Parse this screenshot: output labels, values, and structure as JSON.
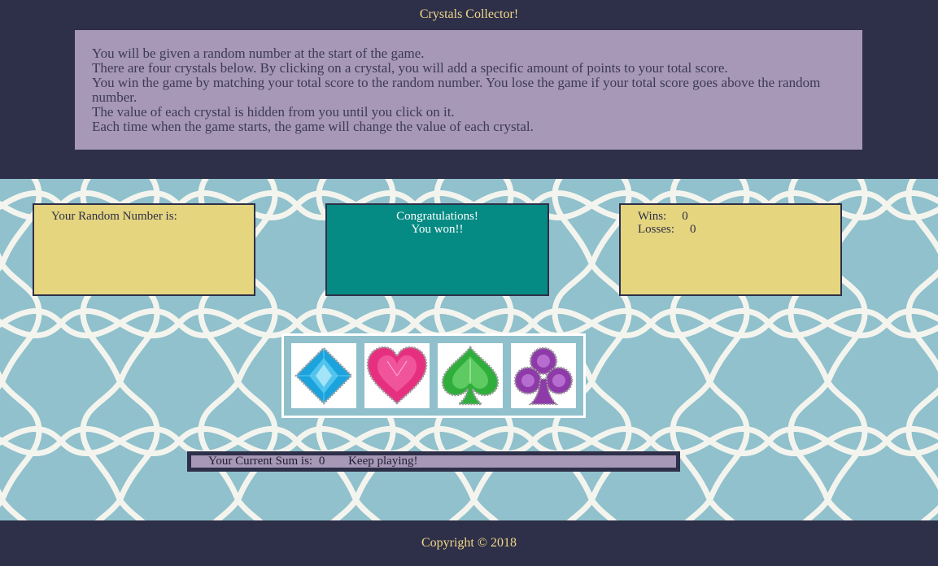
{
  "header": {
    "title": "Crystals Collector!",
    "instructions": [
      "You will be given a random number at the start of the game.",
      "There are four crystals below. By clicking on a crystal, you will add a specific amount of points to your total score.",
      "You win the game by matching your total score to the random number. You lose the game if your total score goes above the random number.",
      "The value of each crystal is hidden from you until you click on it.",
      "Each time when the game starts, the game will change the value of each crystal."
    ]
  },
  "random_panel": {
    "label": "Your Random Number is:",
    "value": ""
  },
  "message_panel": {
    "line1": "Congratulations!",
    "line2": "You won!!"
  },
  "score_panel": {
    "wins_label": "Wins:",
    "wins": "0",
    "losses_label": "Losses:",
    "losses": "0"
  },
  "crystals": [
    {
      "name": "blue-diamond-crystal",
      "color": "#1aa3dd"
    },
    {
      "name": "pink-heart-crystal",
      "color": "#e6307f"
    },
    {
      "name": "green-spade-crystal",
      "color": "#2fae3c"
    },
    {
      "name": "purple-club-crystal",
      "color": "#8e3aa8"
    }
  ],
  "sum_bar": {
    "label": "Your Current Sum is:",
    "value": "0",
    "status": "Keep playing!"
  },
  "footer": {
    "copyright": "Copyright © 2018"
  },
  "colors": {
    "navy": "#2e2f48",
    "gold_text": "#f0d98a",
    "lavender": "#a798b8",
    "sand": "#e5d57f",
    "teal": "#058b84",
    "pattern_bg": "#90c1cc"
  }
}
